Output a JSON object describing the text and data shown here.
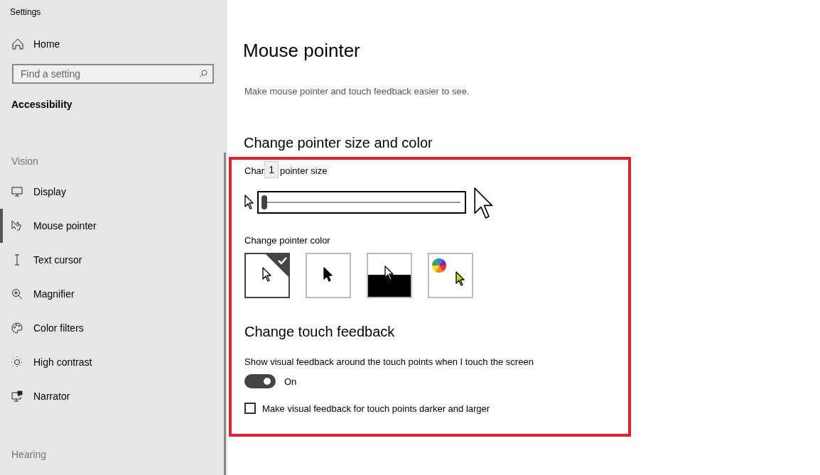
{
  "window": {
    "title": "Settings"
  },
  "sidebar": {
    "home": "Home",
    "search": {
      "placeholder": "Find a setting"
    },
    "section": "Accessibility",
    "groups": [
      {
        "heading": "Vision",
        "items": [
          {
            "label": "Display",
            "kind": "display",
            "selected": false
          },
          {
            "label": "Mouse pointer",
            "kind": "pointer",
            "selected": true
          },
          {
            "label": "Text cursor",
            "kind": "cursor",
            "selected": false
          },
          {
            "label": "Magnifier",
            "kind": "magnifier",
            "selected": false
          },
          {
            "label": "Color filters",
            "kind": "palette",
            "selected": false
          },
          {
            "label": "High contrast",
            "kind": "sun",
            "selected": false
          },
          {
            "label": "Narrator",
            "kind": "narrator",
            "selected": false
          }
        ]
      },
      {
        "heading": "Hearing"
      }
    ]
  },
  "page": {
    "title": "Mouse pointer",
    "subtitle": "Make mouse pointer and touch feedback easier to see.",
    "size_section": {
      "heading": "Change pointer size and color",
      "slider_label_start": "Char",
      "slider_label_end": "pointer size",
      "tooltip": "1",
      "slider": {
        "level": 0.0
      },
      "color_label": "Change pointer color",
      "colors": [
        {
          "kind": "white",
          "selected": true
        },
        {
          "kind": "black",
          "selected": false
        },
        {
          "kind": "inverted",
          "selected": false
        },
        {
          "kind": "custom",
          "selected": false
        }
      ]
    },
    "touch_section": {
      "heading": "Change touch feedback",
      "toggle_label": "Show visual feedback around the touch points when I touch the screen",
      "toggle": {
        "on": true,
        "state_text": "On"
      },
      "checkbox": {
        "label": "Make visual feedback for touch points darker and larger",
        "checked": false
      }
    }
  }
}
